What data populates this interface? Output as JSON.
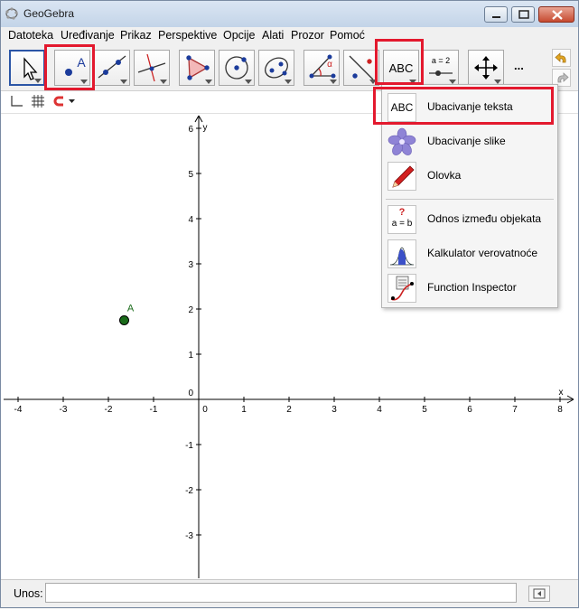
{
  "window": {
    "title": "GeoGebra",
    "icon": "geogebra-logo-icon"
  },
  "menu": [
    "Datoteka",
    "Uređivanje",
    "Prikaz",
    "Perspektive",
    "Opcije",
    "Alati",
    "Prozor",
    "Pomoć"
  ],
  "toolbar": {
    "tools": [
      {
        "name": "move-tool",
        "icon": "arrow-pointer-icon"
      },
      {
        "name": "point-tool",
        "icon": "point-icon",
        "label": "A"
      },
      {
        "name": "line-tool",
        "icon": "line-through-two-points-icon"
      },
      {
        "name": "perpendicular-tool",
        "icon": "perpendicular-line-icon"
      },
      {
        "name": "polygon-tool",
        "icon": "polygon-icon"
      },
      {
        "name": "circle-tool",
        "icon": "circle-center-point-icon"
      },
      {
        "name": "conic-tool",
        "icon": "ellipse-icon"
      },
      {
        "name": "angle-tool",
        "icon": "angle-icon",
        "label": "α"
      },
      {
        "name": "reflect-tool",
        "icon": "reflect-about-line-icon"
      },
      {
        "name": "text-tool",
        "icon": "text-icon",
        "label": "ABC"
      },
      {
        "name": "slider-tool",
        "icon": "slider-icon",
        "label": "a = 2"
      },
      {
        "name": "move-graphics-tool",
        "icon": "move-view-icon"
      }
    ],
    "more_label": "...",
    "undo_icon": "undo-icon",
    "redo_icon": "redo-icon"
  },
  "stylebar": {
    "axes_icon": "axes-icon",
    "grid_icon": "grid-icon",
    "snap_icon": "magnet-icon",
    "dropdown_icon": "chevron-down-icon"
  },
  "graphics": {
    "x_axis_label": "x",
    "y_axis_label": "y",
    "x_ticks": [
      "-4",
      "-3",
      "-2",
      "-1",
      "0",
      "1",
      "2",
      "3",
      "4",
      "5",
      "6",
      "7",
      "8"
    ],
    "y_ticks": [
      "6",
      "5",
      "4",
      "3",
      "2",
      "1",
      "0",
      "-1",
      "-2",
      "-3"
    ],
    "point": {
      "label": "A",
      "x": -1.65,
      "y": 1.75,
      "color": "#1a6b1a"
    }
  },
  "dropdown": {
    "items": [
      {
        "label": "Ubacivanje teksta",
        "icon": "text-icon",
        "icon_text": "ABC"
      },
      {
        "label": "Ubacivanje slike",
        "icon": "image-flower-icon"
      },
      {
        "label": "Olovka",
        "icon": "pen-icon"
      },
      {
        "label": "Odnos između objekata",
        "icon": "relation-icon",
        "icon_text_top": "?",
        "icon_text_bottom": "a = b"
      },
      {
        "label": "Kalkulator verovatnoće",
        "icon": "probability-curve-icon"
      },
      {
        "label": "Function Inspector",
        "icon": "function-inspector-icon"
      }
    ]
  },
  "input_bar": {
    "label": "Unos:",
    "value": "",
    "help_icon": "input-help-icon"
  },
  "colors": {
    "highlight": "#e3192e",
    "point": "#1a6b1a",
    "selected_tool_border": "#2b55a6"
  }
}
